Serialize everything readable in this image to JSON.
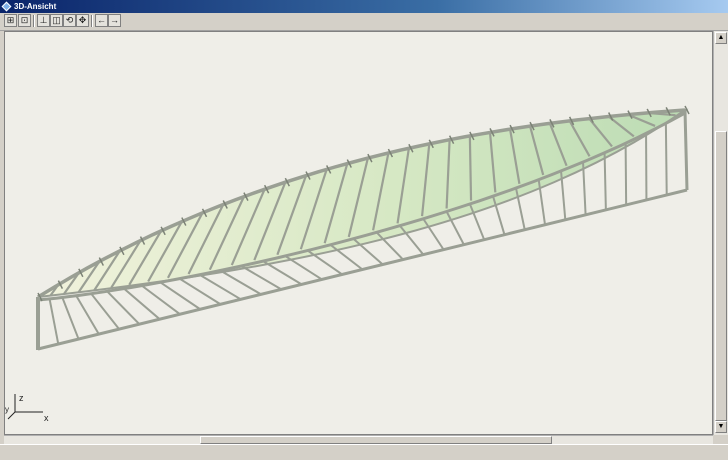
{
  "window": {
    "title": "3D-Ansicht"
  },
  "toolbar": {
    "buttons": [
      {
        "name": "zoom-fit-button",
        "icon": "zoom-fit-icon",
        "glyph": "⊞"
      },
      {
        "name": "zoom-window-button",
        "icon": "zoom-window-icon",
        "glyph": "⊡"
      },
      {
        "name": "view-front-button",
        "icon": "view-front-icon",
        "glyph": "⊥"
      },
      {
        "name": "view-iso-button",
        "icon": "view-iso-icon",
        "glyph": "◫"
      },
      {
        "name": "rotate-button",
        "icon": "rotate-icon",
        "glyph": "⟲"
      },
      {
        "name": "pan-button",
        "icon": "pan-icon",
        "glyph": "✥"
      },
      {
        "name": "undo-view-button",
        "icon": "arrow-left-icon",
        "glyph": "←"
      },
      {
        "name": "redo-view-button",
        "icon": "arrow-right-icon",
        "glyph": "→"
      }
    ]
  },
  "axes": {
    "z": "z",
    "x": "x"
  },
  "colors": {
    "frame": "#9a9f94",
    "roof_light": "#f1f2dc",
    "roof_dark": "#bcdcb4",
    "background": "#efeee8"
  }
}
